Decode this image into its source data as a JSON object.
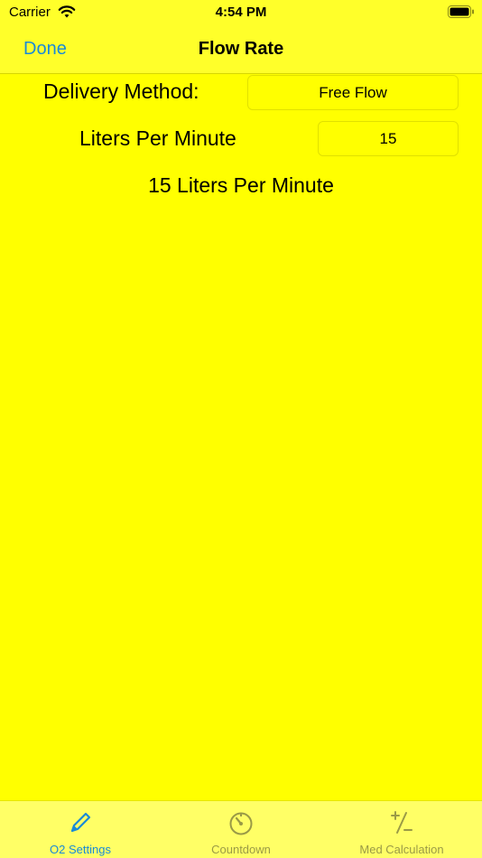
{
  "status_bar": {
    "carrier": "Carrier",
    "time": "4:54 PM"
  },
  "nav": {
    "back_label": "Done",
    "title": "Flow Rate"
  },
  "form": {
    "delivery_label": "Delivery Method:",
    "delivery_value": "Free Flow",
    "lpm_label": "Liters Per Minute",
    "lpm_value": "15",
    "result_text": "15 Liters Per Minute"
  },
  "tabs": [
    {
      "label": "O2 Settings",
      "icon": "pencil-icon",
      "active": true
    },
    {
      "label": "Countdown",
      "icon": "timer-icon",
      "active": false
    },
    {
      "label": "Med Calculation",
      "icon": "plus-minus-icon",
      "active": false
    }
  ],
  "colors": {
    "background": "#ffff00",
    "accent": "#1a8ad6",
    "inactive_tab": "#9a9a46"
  }
}
